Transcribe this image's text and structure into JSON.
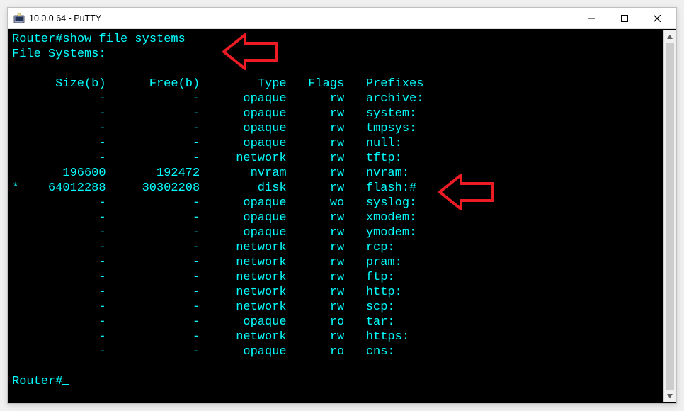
{
  "window": {
    "title": "10.0.0.64 - PuTTY",
    "icon_name": "putty-icon"
  },
  "terminal": {
    "prompt": "Router#",
    "command": "show file systems",
    "subtitle": "File Systems:",
    "final_prompt": "Router#",
    "headers": {
      "size": "Size(b)",
      "free": "Free(b)",
      "type": "Type",
      "flags": "Flags",
      "prefixes": "Prefixes"
    },
    "rows": [
      {
        "star": "",
        "size": "-",
        "free": "-",
        "type": "opaque",
        "flags": "rw",
        "prefix": "archive:"
      },
      {
        "star": "",
        "size": "-",
        "free": "-",
        "type": "opaque",
        "flags": "rw",
        "prefix": "system:"
      },
      {
        "star": "",
        "size": "-",
        "free": "-",
        "type": "opaque",
        "flags": "rw",
        "prefix": "tmpsys:"
      },
      {
        "star": "",
        "size": "-",
        "free": "-",
        "type": "opaque",
        "flags": "rw",
        "prefix": "null:"
      },
      {
        "star": "",
        "size": "-",
        "free": "-",
        "type": "network",
        "flags": "rw",
        "prefix": "tftp:"
      },
      {
        "star": "",
        "size": "196600",
        "free": "192472",
        "type": "nvram",
        "flags": "rw",
        "prefix": "nvram:"
      },
      {
        "star": "*",
        "size": "64012288",
        "free": "30302208",
        "type": "disk",
        "flags": "rw",
        "prefix": "flash:#"
      },
      {
        "star": "",
        "size": "-",
        "free": "-",
        "type": "opaque",
        "flags": "wo",
        "prefix": "syslog:"
      },
      {
        "star": "",
        "size": "-",
        "free": "-",
        "type": "opaque",
        "flags": "rw",
        "prefix": "xmodem:"
      },
      {
        "star": "",
        "size": "-",
        "free": "-",
        "type": "opaque",
        "flags": "rw",
        "prefix": "ymodem:"
      },
      {
        "star": "",
        "size": "-",
        "free": "-",
        "type": "network",
        "flags": "rw",
        "prefix": "rcp:"
      },
      {
        "star": "",
        "size": "-",
        "free": "-",
        "type": "network",
        "flags": "rw",
        "prefix": "pram:"
      },
      {
        "star": "",
        "size": "-",
        "free": "-",
        "type": "network",
        "flags": "rw",
        "prefix": "ftp:"
      },
      {
        "star": "",
        "size": "-",
        "free": "-",
        "type": "network",
        "flags": "rw",
        "prefix": "http:"
      },
      {
        "star": "",
        "size": "-",
        "free": "-",
        "type": "network",
        "flags": "rw",
        "prefix": "scp:"
      },
      {
        "star": "",
        "size": "-",
        "free": "-",
        "type": "opaque",
        "flags": "ro",
        "prefix": "tar:"
      },
      {
        "star": "",
        "size": "-",
        "free": "-",
        "type": "network",
        "flags": "rw",
        "prefix": "https:"
      },
      {
        "star": "",
        "size": "-",
        "free": "-",
        "type": "opaque",
        "flags": "ro",
        "prefix": "cns:"
      }
    ]
  },
  "annotations": {
    "arrow_color": "#ed1c24"
  }
}
